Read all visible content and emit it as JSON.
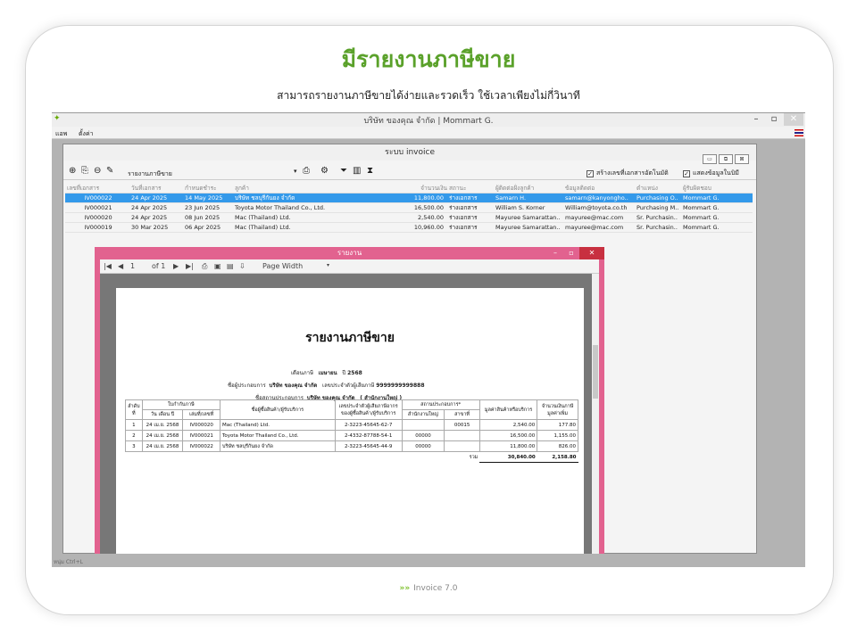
{
  "slide": {
    "headline": "มีรายงานภาษีขาย",
    "subline": "สามารถรายงานภาษีขายได้ง่ายและรวดเร็ว ใช้เวลาเพียงไม่กี่วินาที",
    "footer_logo": "»»",
    "footer": "Invoice 7.0"
  },
  "app": {
    "title": "บริษัท ของคุณ จำกัด | Mommart G.",
    "menu": [
      "แอพ",
      "ตั้งค่า"
    ],
    "minimize": "–",
    "restore": "▫",
    "close": "✕",
    "hint": "หนุ่ม Ctrl+L"
  },
  "invoice": {
    "title": "ระบบ invoice",
    "report_select": "รายงานภาษีขาย",
    "check_auto": "สร้างเลขที่เอกสารอัตโนมัติ",
    "check_show": "แสดงข้อมูลในบิมี",
    "columns": [
      "เลขที่เอกสาร",
      "วันที่เอกสาร",
      "กำหนดชำระ",
      "ลูกค้า",
      "จำนวนเงิน",
      "สถานะ",
      "ผู้ติดต่อฝั่งลูกค้า",
      "ข้อมูลติดต่อ",
      "ตำแหน่ง",
      "ผู้รับผิดชอบ"
    ],
    "rows": [
      [
        "IV000022",
        "24 Apr 2025",
        "14 May 2025",
        "บริษัท ชลบุรีกันยง จำกัด",
        "11,800.00",
        "ร่างเอกสาร",
        "Samarn H.",
        "samarn@kanyongho..",
        "Purchasing O..",
        "Mommart G."
      ],
      [
        "IV000021",
        "24 Apr 2025",
        "23 Jun 2025",
        "Toyota Motor Thailand Co., Ltd.",
        "16,500.00",
        "ร่างเอกสาร",
        "William S. Korner",
        "William@toyota.co.th",
        "Purchasing M..",
        "Mommart G."
      ],
      [
        "IV000020",
        "24 Apr 2025",
        "08 Jun 2025",
        "Mac (Thailand) Ltd.",
        "2,540.00",
        "ร่างเอกสาร",
        "Mayuree Samarattan..",
        "mayuree@mac.com",
        "Sr. Purchasin..",
        "Mommart G."
      ],
      [
        "IV000019",
        "30 Mar 2025",
        "06 Apr 2025",
        "Mac (Thailand) Ltd.",
        "10,960.00",
        "ร่างเอกสาร",
        "Mayuree Samarattan..",
        "mayuree@mac.com",
        "Sr. Purchasin..",
        "Mommart G."
      ]
    ]
  },
  "report_window": {
    "title": "รายงาน",
    "page": "1",
    "of": "of 1",
    "zoom": "Page Width",
    "report_title": "รายงานภาษีขาย",
    "month_label": "เดือนภาษี",
    "month": "เมษายน",
    "year_label": "ปี",
    "year": "2568",
    "operator_label": "ชื่อผู้ประกอบการ",
    "operator": "บริษัท ของคุณ จำกัด",
    "taxid_label": "เลขประจำตัวผู้เสียภาษี",
    "taxid": "9999999999888",
    "place_label": "ชื่อสถานประกอบการ",
    "place": "บริษัท ของคุณ จำกัด",
    "branch": "( สำนักงานใหญ่ )",
    "table": {
      "h_no": "ลำดับที่",
      "h_invoice": "ใบกำกับภาษี",
      "h_date": "วัน เดือน ปี",
      "h_number": "เล่มที่/เลขที่",
      "h_buyer": "ชื่อผู้ซื้อสินค้า/ผู้รับบริการ",
      "h_buyer_tax": "เลขประจำตัวผู้เสียภาษีอากรของผู้ซื้อสินค้า/ผู้รับบริการ",
      "h_place": "สถานประกอบการ*",
      "h_hq": "สำนักงานใหญ่",
      "h_branch": "สาขาที่",
      "h_value": "มูลค่าสินค้าหรือบริการ",
      "h_vat": "จำนวนเงินภาษีมูลค่าเพิ่ม",
      "rows": [
        [
          "1",
          "24 เม.ย. 2568",
          "IV000020",
          "Mac (Thailand) Ltd.",
          "2-3223-45645-62-7",
          "",
          "00015",
          "2,540.00",
          "177.80"
        ],
        [
          "2",
          "24 เม.ย. 2568",
          "IV000021",
          "Toyota Motor Thailand Co., Ltd.",
          "2-4332-87788-54-1",
          "00000",
          "",
          "16,500.00",
          "1,155.00"
        ],
        [
          "3",
          "24 เม.ย. 2568",
          "IV000022",
          "บริษัท ชลบุรีกันยง จำกัด",
          "2-3223-45645-44-9",
          "00000",
          "",
          "11,800.00",
          "826.00"
        ]
      ],
      "sum_label": "รวม",
      "sum_value": "30,840.00",
      "sum_vat": "2,158.80"
    }
  }
}
